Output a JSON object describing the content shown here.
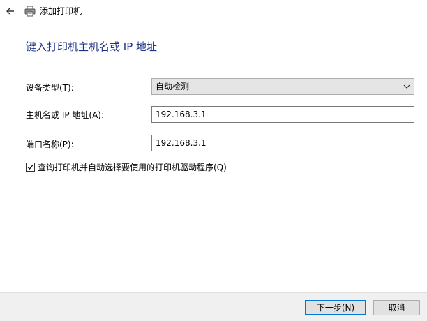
{
  "window": {
    "title": "添加打印机"
  },
  "page": {
    "heading": "键入打印机主机名或 IP 地址"
  },
  "form": {
    "device_type_label": "设备类型(T):",
    "device_type_value": "自动检测",
    "hostname_label": "主机名或 IP 地址(A):",
    "hostname_value": "192.168.3.1",
    "port_label": "端口名称(P):",
    "port_value": "192.168.3.1",
    "auto_driver_label": "查询打印机并自动选择要使用的打印机驱动程序(Q)",
    "auto_driver_checked": true
  },
  "footer": {
    "next_label": "下一步(N)",
    "cancel_label": "取消"
  },
  "icons": {
    "back": "back-arrow-icon",
    "printer": "printer-icon",
    "dropdown": "chevron-down-icon",
    "check": "checkmark-icon"
  },
  "colors": {
    "heading": "#1e3287",
    "primary_button_border": "#0078d7",
    "footer_background": "#f0f0f0"
  }
}
